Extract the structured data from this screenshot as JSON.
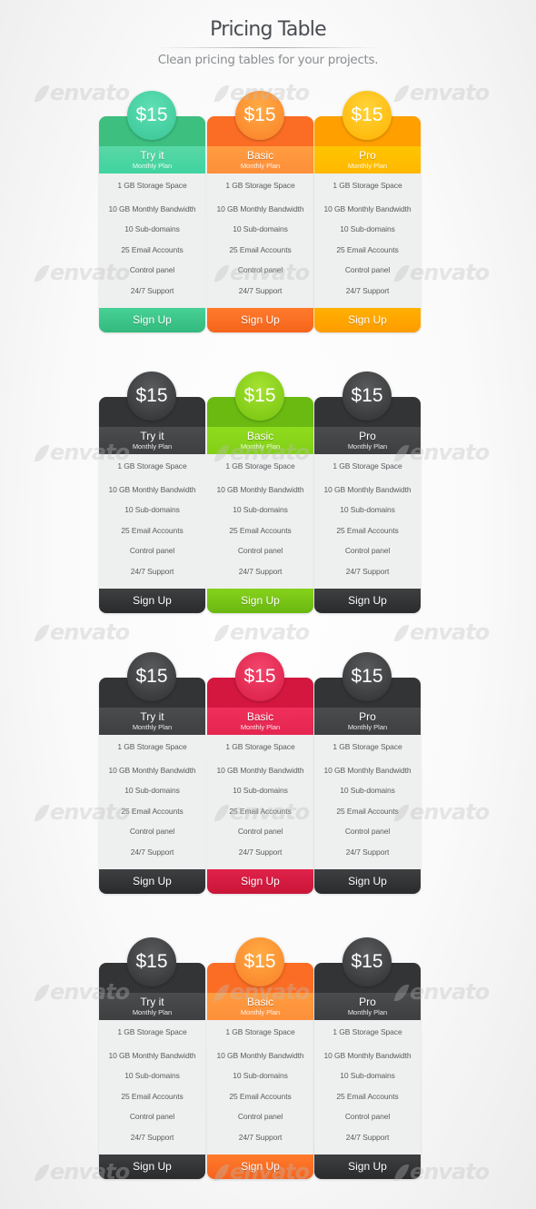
{
  "header": {
    "title": "Pricing Table",
    "subtitle": "Clean pricing tables for your projects."
  },
  "watermark_text": "envato",
  "features": [
    "1 GB Storage Space",
    "10 GB Monthly Bandwidth",
    "10 Sub-domains",
    "25 Email Accounts",
    "Control panel",
    "24/7 Support"
  ],
  "sets": [
    {
      "plans": [
        {
          "name": "Try it",
          "period": "Monthly Plan",
          "price": "$15",
          "cta": "Sign Up",
          "theme": "green",
          "color": "#3cbf7f"
        },
        {
          "name": "Basic",
          "period": "Monthly Plan",
          "price": "$15",
          "cta": "Sign Up",
          "theme": "orange",
          "color": "#fb6d24"
        },
        {
          "name": "Pro",
          "period": "Monthly Plan",
          "price": "$15",
          "cta": "Sign Up",
          "theme": "yellow",
          "color": "#ff9f00"
        }
      ]
    },
    {
      "plans": [
        {
          "name": "Try it",
          "period": "Monthly Plan",
          "price": "$15",
          "cta": "Sign Up",
          "theme": "dark",
          "color": "#333436"
        },
        {
          "name": "Basic",
          "period": "Monthly Plan",
          "price": "$15",
          "cta": "Sign Up",
          "theme": "lime",
          "color": "#6aba12"
        },
        {
          "name": "Pro",
          "period": "Monthly Plan",
          "price": "$15",
          "cta": "Sign Up",
          "theme": "dark",
          "color": "#333436"
        }
      ]
    },
    {
      "plans": [
        {
          "name": "Try it",
          "period": "Monthly Plan",
          "price": "$15",
          "cta": "Sign Up",
          "theme": "dark",
          "color": "#333436"
        },
        {
          "name": "Basic",
          "period": "Monthly Plan",
          "price": "$15",
          "cta": "Sign Up",
          "theme": "pink",
          "color": "#d4173f"
        },
        {
          "name": "Pro",
          "period": "Monthly Plan",
          "price": "$15",
          "cta": "Sign Up",
          "theme": "dark",
          "color": "#333436"
        }
      ]
    },
    {
      "plans": [
        {
          "name": "Try it",
          "period": "Monthly Plan",
          "price": "$15",
          "cta": "Sign Up",
          "theme": "dark",
          "color": "#333436"
        },
        {
          "name": "Basic",
          "period": "Monthly Plan",
          "price": "$15",
          "cta": "Sign Up",
          "theme": "orange",
          "color": "#fb6d24"
        },
        {
          "name": "Pro",
          "period": "Monthly Plan",
          "price": "$15",
          "cta": "Sign Up",
          "theme": "dark",
          "color": "#333436"
        }
      ]
    }
  ]
}
